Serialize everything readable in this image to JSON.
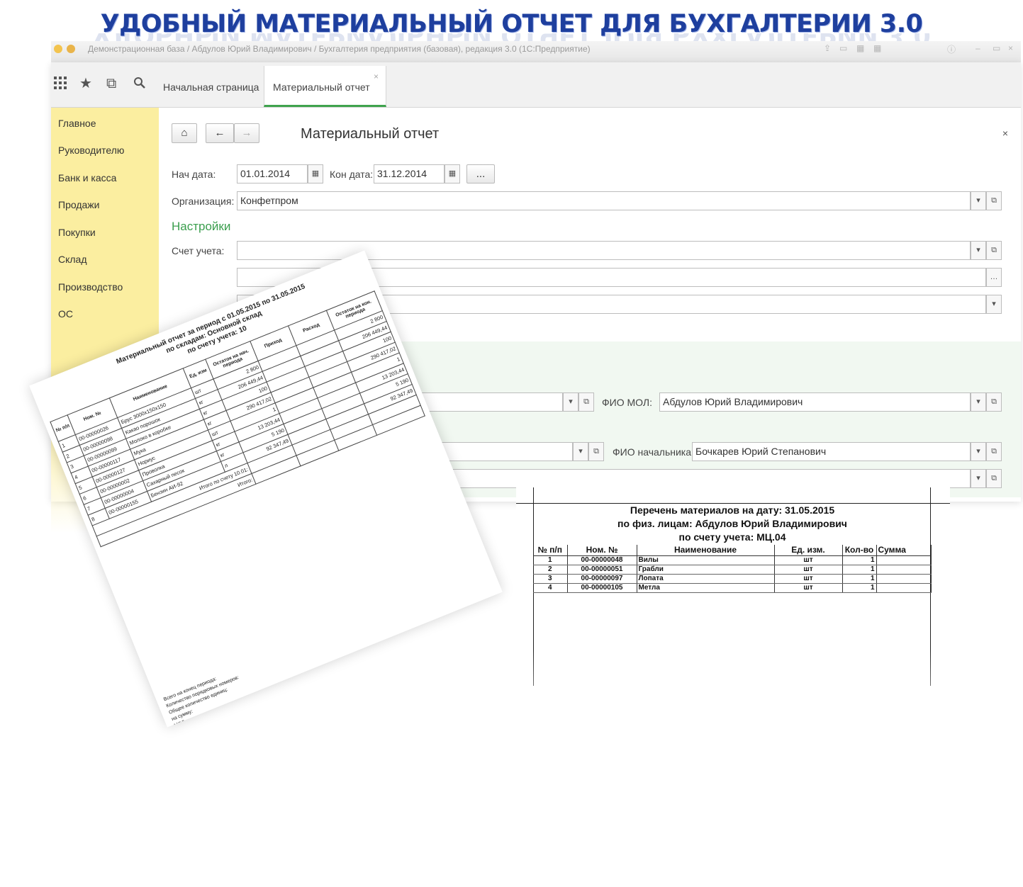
{
  "banner": "УДОБНЫЙ МАТЕРИАЛЬНЫЙ ОТЧЕТ ДЛЯ БУХГАЛТЕРИИ 3.0",
  "window": {
    "title": "Демонстрационная база / Абдулов Юрий Владимирович / Бухгалтерия предприятия (базовая), редакция 3.0  (1С:Предприятие)"
  },
  "tabs": {
    "home": "Начальная страница",
    "active": "Материальный отчет",
    "close": "×"
  },
  "sidebar": {
    "items": [
      "Главное",
      "Руководителю",
      "Банк и касса",
      "Продажи",
      "Покупки",
      "Склад",
      "Производство",
      "ОС"
    ]
  },
  "form": {
    "title": "Материальный отчет",
    "close": "×",
    "start_label": "Нач дата:",
    "start_value": "01.01.2014",
    "end_label": "Кон дата:",
    "end_value": "31.12.2014",
    "period_button": "...",
    "org_label": "Организация:",
    "org_value": "Конфетпром",
    "settings_title": "Настройки",
    "account_label": "Счет учета:",
    "mol_label": "ФИО МОЛ:",
    "mol_value": "Абдулов Юрий Владимирович",
    "chief_label": "ФИО начальника:",
    "chief_value": "Бочкарев Юрий Степанович"
  },
  "print_list": {
    "title1": "Перечень материалов на дату: 31.05.2015",
    "title2": "по физ. лицам: Абдулов Юрий Владимирович",
    "title3": "по счету учета: МЦ.04",
    "headers": [
      "№ п/п",
      "Ном. №",
      "Наименование",
      "Ед. изм.",
      "Кол-во",
      "Сумма"
    ],
    "rows": [
      [
        "1",
        "00-00000048",
        "Вилы",
        "шт",
        "1",
        ""
      ],
      [
        "2",
        "00-00000051",
        "Грабли",
        "шт",
        "1",
        ""
      ],
      [
        "3",
        "00-00000097",
        "Лопата",
        "шт",
        "1",
        ""
      ],
      [
        "4",
        "00-00000105",
        "Метла",
        "шт",
        "1",
        ""
      ]
    ]
  },
  "material_report": {
    "title1": "Материальный отчет за период с 01.05.2015 по 31.05.2015",
    "title2": "по складам: Основной склад",
    "title3": "по счету учета: 10",
    "headers": [
      "№ п/п",
      "Ном. №",
      "Наименование",
      "Ед. изм",
      "Остаток на нач. периода",
      "Приход",
      "Расход",
      "Остаток на кон. периода"
    ],
    "rows": [
      [
        "1",
        "00-00000026",
        "Брус 3000х150х150",
        "шт",
        "2 800",
        "",
        "",
        "2 800"
      ],
      [
        "2",
        "00-00000098",
        "Какао порошок",
        "кг",
        "206 449,44",
        "",
        "",
        "206 449,44"
      ],
      [
        "3",
        "00-00000099",
        "Молоко в коробке",
        "кг",
        "100",
        "",
        "",
        "100"
      ],
      [
        "4",
        "00-00000117",
        "Мука",
        "кг",
        "290 417,02",
        "",
        "",
        "290 417,02"
      ],
      [
        "5",
        "00-00000127",
        "Нориус",
        "шт",
        "1",
        "",
        "",
        "1"
      ],
      [
        "6",
        "00-00000002",
        "Проволка",
        "кг",
        "13 203,44",
        "",
        "",
        "13 203,44"
      ],
      [
        "7",
        "00-00000004",
        "Сахарный песок",
        "кг",
        "5 190",
        "",
        "",
        "5 190"
      ],
      [
        "8",
        "00-00000155",
        "Бензин АИ-92",
        "л",
        "92 347,49",
        "",
        "",
        "92 347,49"
      ]
    ],
    "subtotal_label": "Итого по счету 10.01:",
    "total_label": "Итого:",
    "footer1": "Всего на конец периода:",
    "footer2": "Количество порядковых номеров:",
    "footer3": "Общее количество единиц:",
    "footer4": "на сумму:",
    "footer5": "МОЛ"
  }
}
